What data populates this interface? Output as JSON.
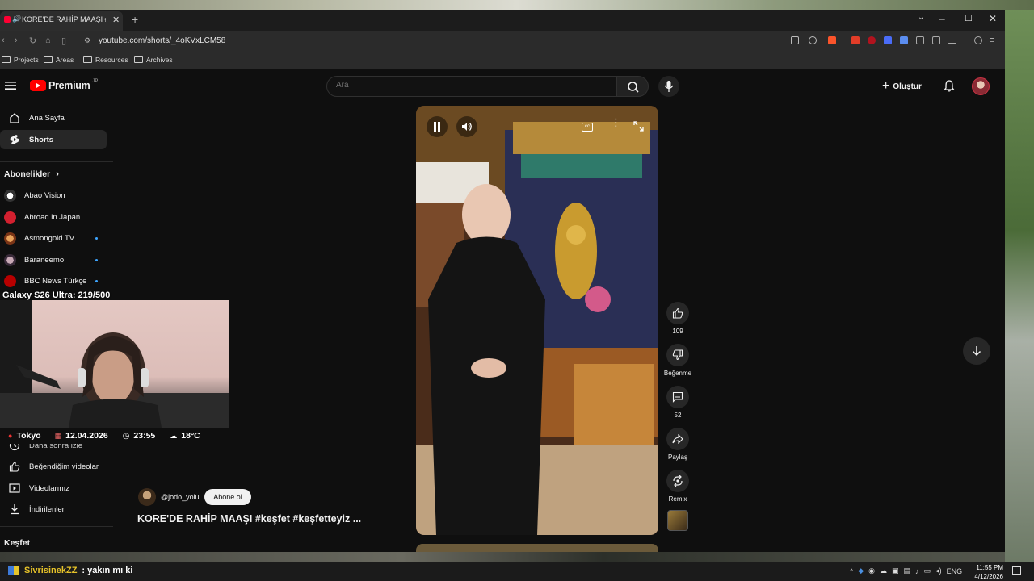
{
  "browser": {
    "tab_title": "KORE'DE RAHİP MAAŞI #keşfet",
    "url": "youtube.com/shorts/_4oKVxLCM58",
    "bookmarks": [
      "Projects",
      "Areas",
      "Resources",
      "Archives"
    ]
  },
  "youtube": {
    "logo_text": "Premium",
    "logo_region": "JP",
    "search_placeholder": "Ara",
    "create_label": "Oluştur",
    "accent": "#ff0000"
  },
  "sidebar": {
    "nav": [
      {
        "label": "Ana Sayfa",
        "icon": "home-icon"
      },
      {
        "label": "Shorts",
        "icon": "shorts-icon"
      }
    ],
    "subscriptions_header": "Abonelikler",
    "subscriptions": [
      {
        "label": "Abao Vision",
        "new": false
      },
      {
        "label": "Abroad in Japan",
        "new": false
      },
      {
        "label": "Asmongold TV",
        "new": true
      },
      {
        "label": "Baraneemo",
        "new": true
      },
      {
        "label": "BBC News Türkçe",
        "new": true
      }
    ],
    "you_items": [
      {
        "label": "Daha sonra izle",
        "icon": "clock-icon"
      },
      {
        "label": "Beğendiğim videolar",
        "icon": "like-icon"
      },
      {
        "label": "Videolarınız",
        "icon": "video-icon"
      },
      {
        "label": "İndirilenler",
        "icon": "download-icon"
      }
    ],
    "explore_header": "Keşfet"
  },
  "stream_overlay": {
    "goal_label": "Galaxy S26 Ultra: 219/500",
    "city": "Tokyo",
    "date": "12.04.2026",
    "time": "23:55",
    "temperature": "18°C",
    "chat_user": "SivrisinekZZ",
    "chat_message": ": yakın mı ki"
  },
  "short": {
    "channel": "@jodo_yolu",
    "subscribe_label": "Abone ol",
    "title": "KORE'DE RAHİP MAAŞI #keşfet #keşfetteyiz ...",
    "likes": "109",
    "dislike_label": "Beğenme",
    "comments": "52",
    "share_label": "Paylaş",
    "remix_label": "Remix"
  },
  "taskbar": {
    "language": "ENG",
    "time": "11:55 PM",
    "date": "4/12/2026"
  }
}
